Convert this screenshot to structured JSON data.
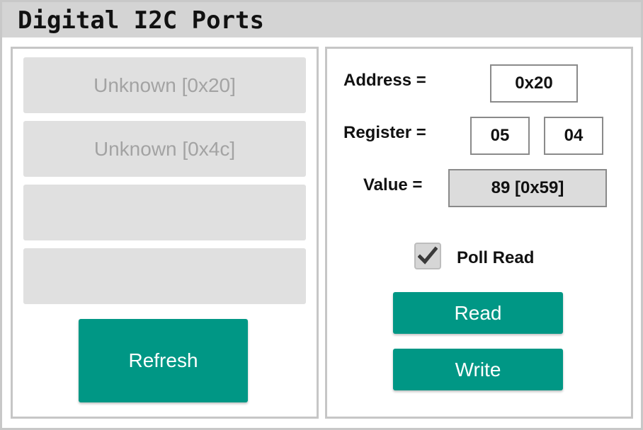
{
  "window": {
    "title": "Digital I2C Ports"
  },
  "devices": [
    {
      "label": "Unknown [0x20]"
    },
    {
      "label": "Unknown [0x4c]"
    },
    {
      "label": ""
    },
    {
      "label": ""
    }
  ],
  "left": {
    "refresh_label": "Refresh"
  },
  "form": {
    "address_label": "Address =",
    "address_value": "0x20",
    "register_label": "Register =",
    "register_high": "05",
    "register_low": "04",
    "value_label": "Value =",
    "value_display": "89 [0x59]",
    "poll_label": "Poll Read",
    "poll_checked": true,
    "read_label": "Read",
    "write_label": "Write"
  },
  "colors": {
    "accent": "#009785",
    "slot_bg": "#e0e0e0",
    "title_bar": "#d4d4d4"
  },
  "icons": {
    "checkbox": "checkmark-icon"
  }
}
